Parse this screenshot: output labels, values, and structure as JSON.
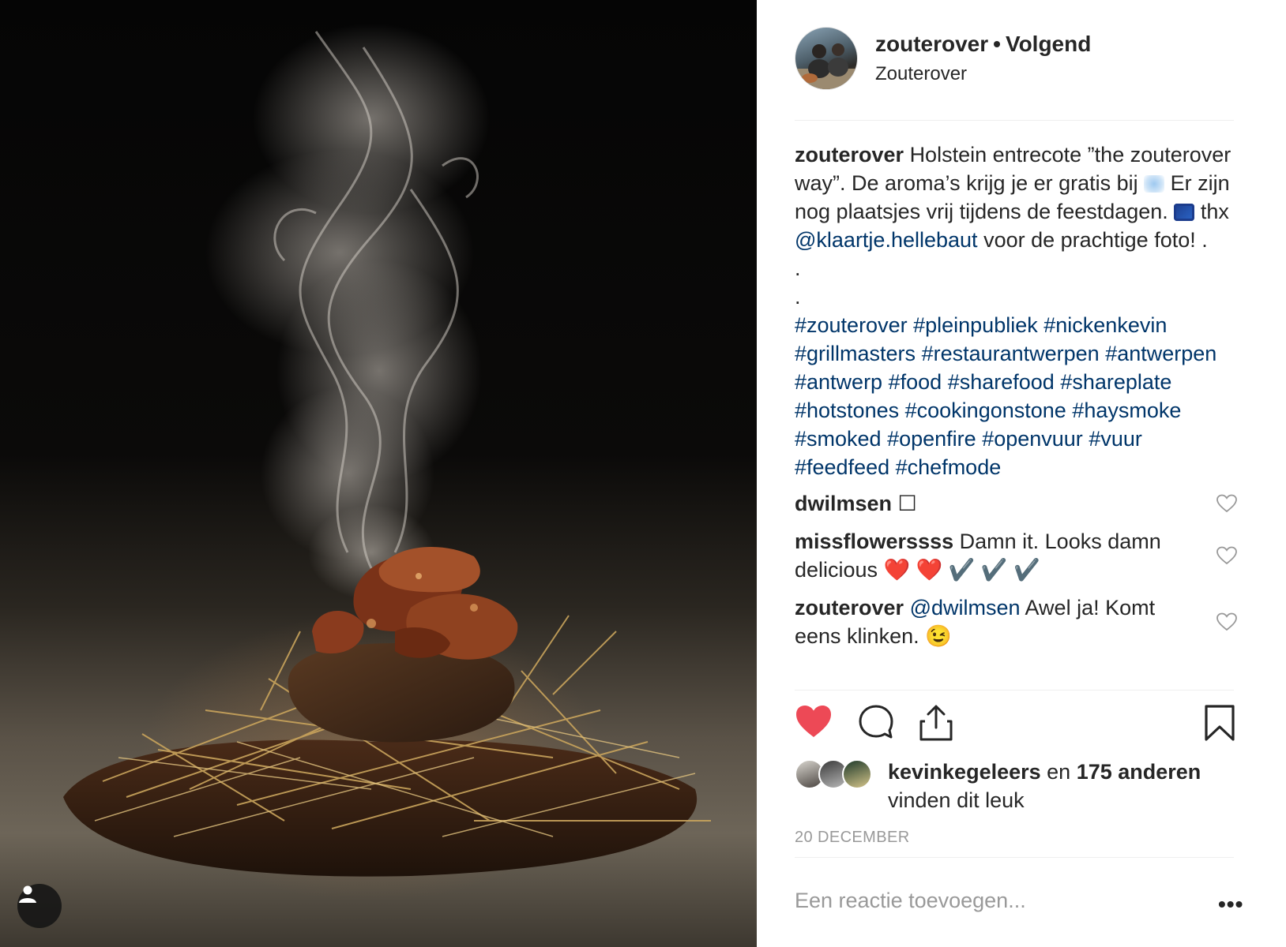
{
  "post": {
    "username": "zouterover",
    "separator": "•",
    "follow_status": "Volgend",
    "location": "Zouterover"
  },
  "caption": {
    "username": "zouterover",
    "text_1": "Holstein entrecote ”the zouterover way”. De aroma’s krijg je er gratis bij",
    "text_2": "Er zijn nog plaatsjes vrij tijdens de feestdagen.",
    "text_3": "thx",
    "mention": "@klaartje.hellebaut",
    "text_4": "voor de prachtige foto! .",
    "dot_1": ".",
    "dot_2": ".",
    "hashtags": [
      "#zouterover",
      "#pleinpubliek",
      "#nickenkevin",
      "#grillmasters",
      "#restaurantwerpen",
      "#antwerpen",
      "#antwerp",
      "#food",
      "#sharefood",
      "#shareplate",
      "#hotstones",
      "#cookingonstone",
      "#haysmoke",
      "#smoked",
      "#openfire",
      "#openvuur",
      "#vuur",
      "#feedfeed",
      "#chefmode"
    ]
  },
  "comments": [
    {
      "username": "dwilmsen",
      "text": "☐"
    },
    {
      "username": "missflowerssss",
      "text": "Damn it. Looks damn delicious",
      "emojis": "❤️ ❤️ ✔️ ✔️ ✔️"
    },
    {
      "username": "zouterover",
      "mention": "@dwilmsen",
      "text": "Awel ja! Komt eens klinken.",
      "emoji": "😉"
    }
  ],
  "likes": {
    "first_liker": "kevinkegeleers",
    "connector": "en",
    "others": "175 anderen",
    "suffix": "vinden dit leuk"
  },
  "date": "20 DECEMBER",
  "add_comment_placeholder": "Een reactie toevoegen...",
  "more_label": "•••",
  "icons": {
    "like": "heart-filled-icon",
    "comment": "comment-bubble-icon",
    "share": "share-icon",
    "save": "bookmark-icon",
    "comment_like": "heart-outline-icon",
    "tagged_user": "user-tag-icon"
  },
  "colors": {
    "like_red": "#ed4956",
    "link_blue": "#003569",
    "text": "#262626",
    "muted": "#999999"
  }
}
